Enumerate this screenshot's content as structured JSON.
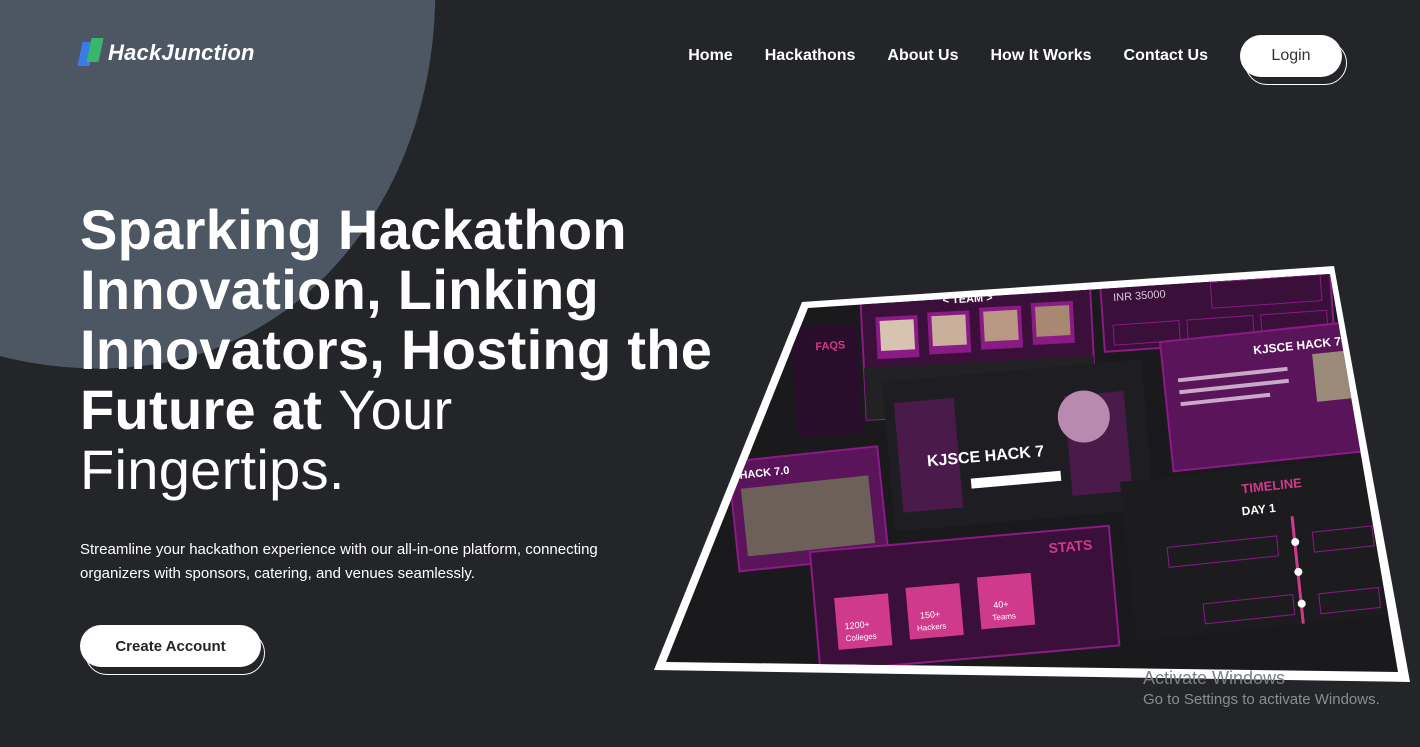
{
  "brand": {
    "name": "HackJunction"
  },
  "nav": {
    "items": [
      "Home",
      "Hackathons",
      "About Us",
      "How It Works",
      "Contact Us"
    ],
    "login_label": "Login"
  },
  "hero": {
    "title_bold": "Sparking Hackathon Innovation, Linking Innovators, Hosting the Future at ",
    "title_light": "Your Fingertips.",
    "subtitle": "Streamline your hackathon experience with our all-in-one platform, connecting organizers with sponsors, catering, and venues seamlessly.",
    "cta_label": "Create Account"
  },
  "preview": {
    "team_heading": "< TEAM >",
    "faqs_heading": "FAQS",
    "event_banner": "KJSCE HACK 7",
    "hack_heading": "HACK 7.0",
    "event_title": "KJSCE HACK 7",
    "timeline_heading": "TIMELINE",
    "day_label": "DAY 1",
    "stats_heading": "STATS",
    "stats": [
      {
        "value": "1200+",
        "label": "Colleges"
      },
      {
        "value": "150+",
        "label": "Hackers"
      },
      {
        "value": "40+",
        "label": "Teams"
      }
    ],
    "prize_text": "INR 35000",
    "accent_color": "#8a1a86"
  },
  "watermark": {
    "title": "Activate Windows",
    "subtitle": "Go to Settings to activate Windows."
  }
}
